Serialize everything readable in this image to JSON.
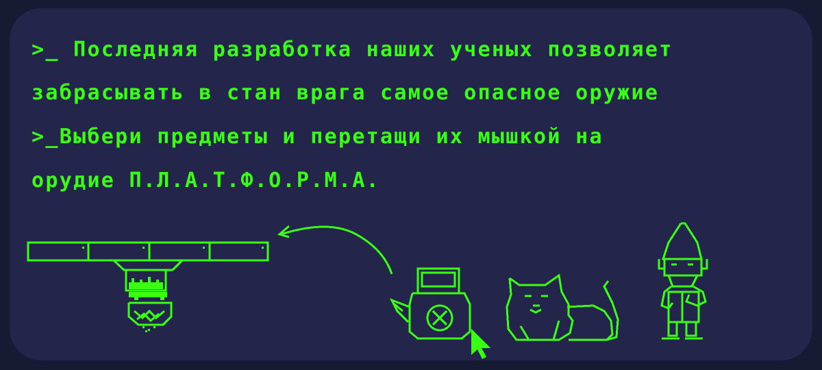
{
  "terminal": {
    "lines": [
      ">_ Последняя разработка наших ученых позволяет",
      "забрасывать в стан врага самое опасное оружие",
      ">_Выбери предметы и перетащи их мышкой на",
      "орудие П.Л.А.Т.Ф.О.Р.М.А."
    ]
  },
  "colors": {
    "outer_bg": "#171a33",
    "screen_bg": "#23264a",
    "accent": "#39ff14"
  },
  "items": [
    {
      "name": "weapon-platform",
      "icon": "platform-cannon-icon"
    },
    {
      "name": "kettle",
      "icon": "kettle-icon"
    },
    {
      "name": "cat",
      "icon": "cat-icon"
    },
    {
      "name": "gnome",
      "icon": "gnome-icon"
    }
  ]
}
